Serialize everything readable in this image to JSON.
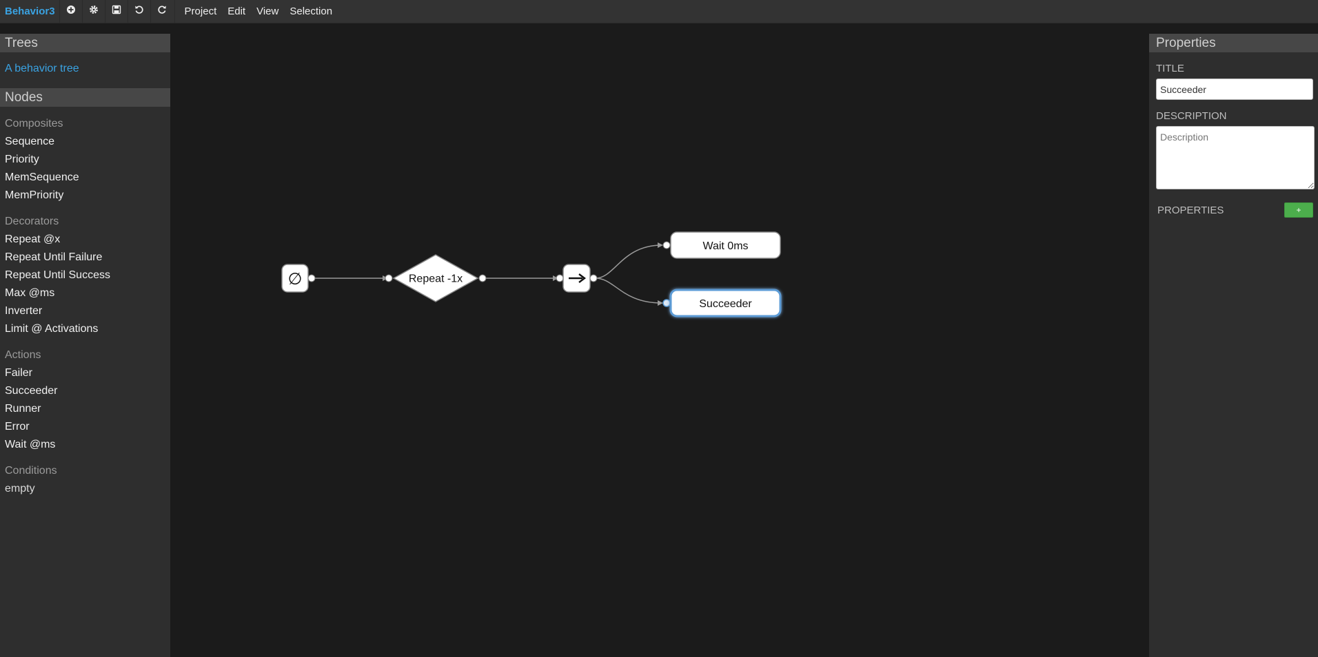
{
  "app": {
    "logo": "Behavior3"
  },
  "toolbar": {
    "buttons": [
      {
        "icon": "add-circle-icon"
      },
      {
        "icon": "gear-icon"
      },
      {
        "icon": "save-icon"
      },
      {
        "icon": "undo-icon"
      },
      {
        "icon": "redo-icon"
      }
    ],
    "menu": [
      "Project",
      "Edit",
      "View",
      "Selection"
    ]
  },
  "sidebar": {
    "trees_header": "Trees",
    "trees": [
      "A behavior tree"
    ],
    "nodes_header": "Nodes",
    "groups": [
      {
        "label": "Composites",
        "items": [
          "Sequence",
          "Priority",
          "MemSequence",
          "MemPriority"
        ]
      },
      {
        "label": "Decorators",
        "items": [
          "Repeat @x",
          "Repeat Until Failure",
          "Repeat Until Success",
          "Max @ms",
          "Inverter",
          "Limit @ Activations"
        ]
      },
      {
        "label": "Actions",
        "items": [
          "Failer",
          "Succeeder",
          "Runner",
          "Error",
          "Wait @ms"
        ]
      },
      {
        "label": "Conditions",
        "items": [
          "empty"
        ]
      }
    ]
  },
  "graph": {
    "root_symbol": "∅",
    "repeat_label": "Repeat -1x",
    "sequence_symbol": "→",
    "wait_label": "Wait 0ms",
    "succeeder_label": "Succeeder",
    "selected_node": "Succeeder"
  },
  "properties": {
    "header": "Properties",
    "title_label": "TITLE",
    "title_value": "Succeeder",
    "description_label": "DESCRIPTION",
    "description_placeholder": "Description",
    "properties_label": "PROPERTIES",
    "add_button": "+"
  },
  "colors": {
    "accent": "#3aa3e3",
    "add_button": "#4cae4c",
    "selection_glow": "#5b9bd5"
  }
}
